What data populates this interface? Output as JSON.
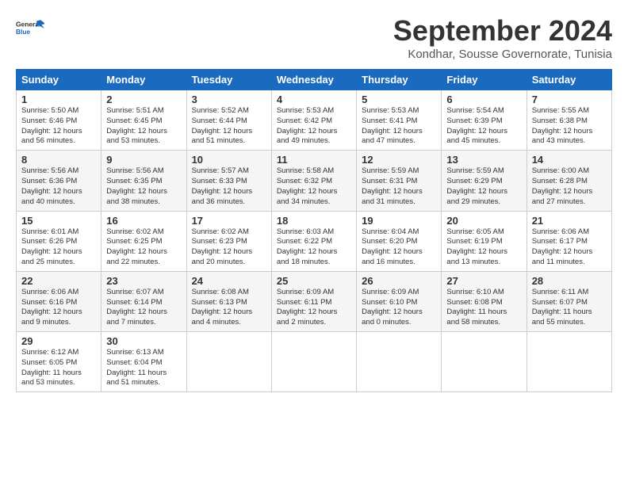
{
  "header": {
    "logo_line1": "General",
    "logo_line2": "Blue",
    "month_year": "September 2024",
    "location": "Kondhar, Sousse Governorate, Tunisia"
  },
  "weekdays": [
    "Sunday",
    "Monday",
    "Tuesday",
    "Wednesday",
    "Thursday",
    "Friday",
    "Saturday"
  ],
  "weeks": [
    [
      {
        "day": "1",
        "info": "Sunrise: 5:50 AM\nSunset: 6:46 PM\nDaylight: 12 hours\nand 56 minutes."
      },
      {
        "day": "2",
        "info": "Sunrise: 5:51 AM\nSunset: 6:45 PM\nDaylight: 12 hours\nand 53 minutes."
      },
      {
        "day": "3",
        "info": "Sunrise: 5:52 AM\nSunset: 6:44 PM\nDaylight: 12 hours\nand 51 minutes."
      },
      {
        "day": "4",
        "info": "Sunrise: 5:53 AM\nSunset: 6:42 PM\nDaylight: 12 hours\nand 49 minutes."
      },
      {
        "day": "5",
        "info": "Sunrise: 5:53 AM\nSunset: 6:41 PM\nDaylight: 12 hours\nand 47 minutes."
      },
      {
        "day": "6",
        "info": "Sunrise: 5:54 AM\nSunset: 6:39 PM\nDaylight: 12 hours\nand 45 minutes."
      },
      {
        "day": "7",
        "info": "Sunrise: 5:55 AM\nSunset: 6:38 PM\nDaylight: 12 hours\nand 43 minutes."
      }
    ],
    [
      {
        "day": "8",
        "info": "Sunrise: 5:56 AM\nSunset: 6:36 PM\nDaylight: 12 hours\nand 40 minutes."
      },
      {
        "day": "9",
        "info": "Sunrise: 5:56 AM\nSunset: 6:35 PM\nDaylight: 12 hours\nand 38 minutes."
      },
      {
        "day": "10",
        "info": "Sunrise: 5:57 AM\nSunset: 6:33 PM\nDaylight: 12 hours\nand 36 minutes."
      },
      {
        "day": "11",
        "info": "Sunrise: 5:58 AM\nSunset: 6:32 PM\nDaylight: 12 hours\nand 34 minutes."
      },
      {
        "day": "12",
        "info": "Sunrise: 5:59 AM\nSunset: 6:31 PM\nDaylight: 12 hours\nand 31 minutes."
      },
      {
        "day": "13",
        "info": "Sunrise: 5:59 AM\nSunset: 6:29 PM\nDaylight: 12 hours\nand 29 minutes."
      },
      {
        "day": "14",
        "info": "Sunrise: 6:00 AM\nSunset: 6:28 PM\nDaylight: 12 hours\nand 27 minutes."
      }
    ],
    [
      {
        "day": "15",
        "info": "Sunrise: 6:01 AM\nSunset: 6:26 PM\nDaylight: 12 hours\nand 25 minutes."
      },
      {
        "day": "16",
        "info": "Sunrise: 6:02 AM\nSunset: 6:25 PM\nDaylight: 12 hours\nand 22 minutes."
      },
      {
        "day": "17",
        "info": "Sunrise: 6:02 AM\nSunset: 6:23 PM\nDaylight: 12 hours\nand 20 minutes."
      },
      {
        "day": "18",
        "info": "Sunrise: 6:03 AM\nSunset: 6:22 PM\nDaylight: 12 hours\nand 18 minutes."
      },
      {
        "day": "19",
        "info": "Sunrise: 6:04 AM\nSunset: 6:20 PM\nDaylight: 12 hours\nand 16 minutes."
      },
      {
        "day": "20",
        "info": "Sunrise: 6:05 AM\nSunset: 6:19 PM\nDaylight: 12 hours\nand 13 minutes."
      },
      {
        "day": "21",
        "info": "Sunrise: 6:06 AM\nSunset: 6:17 PM\nDaylight: 12 hours\nand 11 minutes."
      }
    ],
    [
      {
        "day": "22",
        "info": "Sunrise: 6:06 AM\nSunset: 6:16 PM\nDaylight: 12 hours\nand 9 minutes."
      },
      {
        "day": "23",
        "info": "Sunrise: 6:07 AM\nSunset: 6:14 PM\nDaylight: 12 hours\nand 7 minutes."
      },
      {
        "day": "24",
        "info": "Sunrise: 6:08 AM\nSunset: 6:13 PM\nDaylight: 12 hours\nand 4 minutes."
      },
      {
        "day": "25",
        "info": "Sunrise: 6:09 AM\nSunset: 6:11 PM\nDaylight: 12 hours\nand 2 minutes."
      },
      {
        "day": "26",
        "info": "Sunrise: 6:09 AM\nSunset: 6:10 PM\nDaylight: 12 hours\nand 0 minutes."
      },
      {
        "day": "27",
        "info": "Sunrise: 6:10 AM\nSunset: 6:08 PM\nDaylight: 11 hours\nand 58 minutes."
      },
      {
        "day": "28",
        "info": "Sunrise: 6:11 AM\nSunset: 6:07 PM\nDaylight: 11 hours\nand 55 minutes."
      }
    ],
    [
      {
        "day": "29",
        "info": "Sunrise: 6:12 AM\nSunset: 6:05 PM\nDaylight: 11 hours\nand 53 minutes."
      },
      {
        "day": "30",
        "info": "Sunrise: 6:13 AM\nSunset: 6:04 PM\nDaylight: 11 hours\nand 51 minutes."
      },
      {
        "day": "",
        "info": ""
      },
      {
        "day": "",
        "info": ""
      },
      {
        "day": "",
        "info": ""
      },
      {
        "day": "",
        "info": ""
      },
      {
        "day": "",
        "info": ""
      }
    ]
  ]
}
